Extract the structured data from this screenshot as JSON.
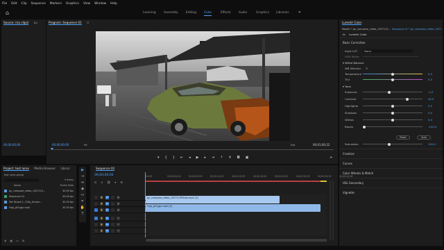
{
  "menu": [
    "File",
    "Edit",
    "Clip",
    "Sequence",
    "Markers",
    "Graphics",
    "View",
    "Window",
    "Help"
  ],
  "workspaces": [
    "Learning",
    "Assembly",
    "Editing",
    "Color",
    "Effects",
    "Audio",
    "Graphics",
    "Libraries"
  ],
  "active_workspace": "Color",
  "source_panel": {
    "tabs": [
      "Source: (no clips)",
      "Lu"
    ],
    "timecode": "00;00;00;00"
  },
  "program_monitor": {
    "title": "Program: Sequence 01",
    "timecode": "00;00;00;00",
    "fit": "Fit",
    "quality": "Full",
    "duration": "00;01;00;22",
    "buttons": [
      "marker-icon",
      "in-icon",
      "out-icon",
      "go-to-in-icon",
      "step-back-icon",
      "play-icon",
      "step-forward-icon",
      "go-to-out-icon",
      "lift-icon",
      "extract-icon",
      "export-frame-icon",
      "compare-icon",
      "add-icon"
    ]
  },
  "lumetri": {
    "panel_title": "Lumetri Color",
    "master_label": "Master * gn_compose_video_1307115...",
    "seq_label": "Sequence 01 * gn_compose_video_1307...",
    "effect_name": "Lumetri Color",
    "basic_correction": "Basic Correction",
    "input_lut_label": "Input LUT",
    "input_lut_value": "None",
    "hdr_white_label": "HDR White",
    "white_balance": "White Balance",
    "wb_selector": "WB Selector",
    "temperature_label": "Temperature",
    "temperature_value": "0.0",
    "tint_label": "Tint",
    "tint_value": "0.0",
    "tone": "Tone",
    "tone_rows": [
      {
        "label": "Exposure",
        "value": "-1.0"
      },
      {
        "label": "Contrast",
        "value": "40.0"
      },
      {
        "label": "Highlights",
        "value": "0.0"
      },
      {
        "label": "Shadows",
        "value": "0.0"
      },
      {
        "label": "Whites",
        "value": "0.0"
      },
      {
        "label": "Blacks",
        "value": "-100.0"
      }
    ],
    "reset": "Reset",
    "auto": "Auto",
    "saturation_label": "Saturation",
    "saturation_value": "100.0",
    "sections": [
      "Creative",
      "Curves",
      "Color Wheels & Match",
      "HSL Secondary",
      "Vignette"
    ]
  },
  "project": {
    "tabs": [
      "Project: test lume",
      "Media Browser",
      "Librari"
    ],
    "file": "test lume.prproj",
    "count": "4 Items",
    "col_name": "Name",
    "col_rate": "Frame Rate",
    "items": [
      {
        "name": "gn_compose_video_1307115...",
        "rate": "30.00 fps",
        "color": "#5a9bdb"
      },
      {
        "name": "Sequence 01",
        "rate": "30.00 fps",
        "color": "#3fa06b"
      },
      {
        "name": "Tak Terjadi 1_720p_Kmyte...",
        "rate": "30.00 fps",
        "color": "#5a9bdb"
      },
      {
        "name": "Yugi_gt7ygjo.mp4",
        "rate": "30.00 fps",
        "color": "#5a9bdb"
      }
    ]
  },
  "timeline": {
    "title": "Sequence 01",
    "timecode": "00;00;00;00",
    "ruler": [
      "00;00",
      "00;00;04;29",
      "00;00;09;29",
      "00;00;14;29",
      "00;00;19;29",
      "00;00;24;29",
      "00;00;29;29",
      "00;00;34;29",
      "00;00;39;29",
      "00;00;44;28"
    ],
    "video_tracks": [
      "V3",
      "V2",
      "V1"
    ],
    "audio_tracks": [
      "A1",
      "A2",
      "A3"
    ],
    "clip_v2": "gn_compose_video_1307115Pikolo.mp4 [V]",
    "clip_v1": "Yugi_gt7ygjo.mp4 [V]"
  },
  "colors": {
    "accent": "#4fa3ff",
    "clip_v2": "#a8c9ef",
    "clip_v1": "#8fb8e8",
    "panel": "#1d1d1d",
    "background": "#0e0e0e"
  }
}
